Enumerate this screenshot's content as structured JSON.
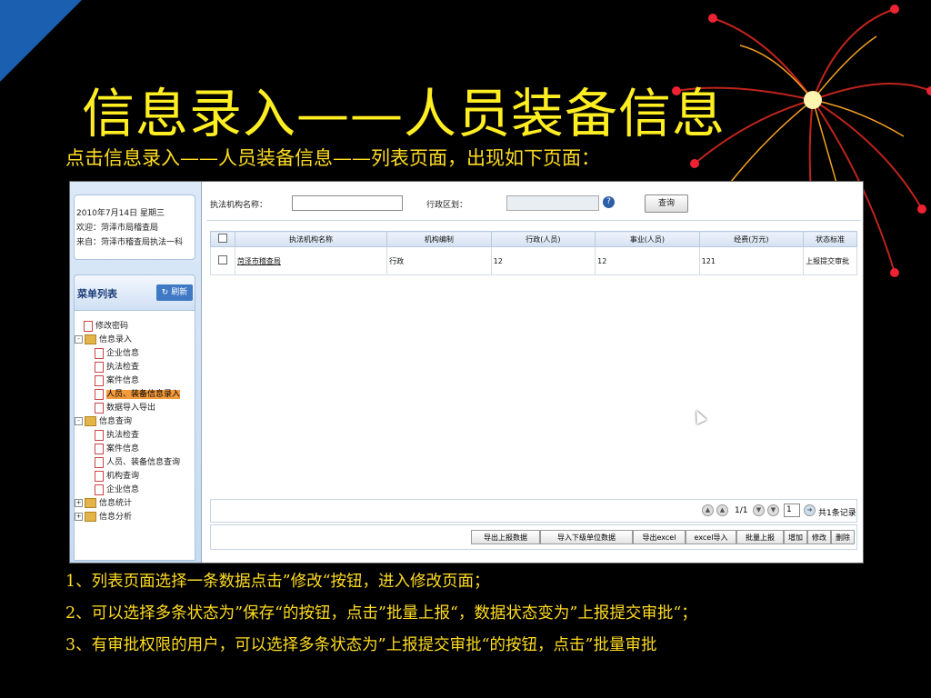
{
  "slide": {
    "title": "信息录入——人员装备信息",
    "subtitle": "点击信息录入——人员装备信息——列表页面，出现如下页面：",
    "notes": [
      "1、列表页面选择一条数据点击”修改“按钮，进入修改页面；",
      "2、可以选择多条状态为”保存“的按钮，点击”批量上报“，数据状态变为”上报提交审批“；",
      "3、有审批权限的用户，可以选择多条状态为”上报提交审批“的按钮，点击”批量审批"
    ]
  },
  "info": {
    "date": "2010年7月14日 星期三",
    "welcome": "欢迎：菏泽市局稽查局",
    "from": "来自：菏泽市稽查局执法一科"
  },
  "menu": {
    "title": "菜单列表",
    "refresh": "刷新",
    "tree": [
      {
        "label": "修改密码"
      },
      {
        "label": "信息录入"
      },
      {
        "label": "企业信息"
      },
      {
        "label": "执法检查"
      },
      {
        "label": "案件信息"
      },
      {
        "label": "人员、装备信息录入"
      },
      {
        "label": "数据导入导出"
      },
      {
        "label": "信息查询"
      },
      {
        "label": "执法检查"
      },
      {
        "label": "案件信息"
      },
      {
        "label": "人员、装备信息查询"
      },
      {
        "label": "机构查询"
      },
      {
        "label": "企业信息"
      },
      {
        "label": "信息统计"
      },
      {
        "label": "信息分析"
      }
    ]
  },
  "search": {
    "org_label": "执法机构名称：",
    "region_label": "行政区划：",
    "org_value": "",
    "region_value": "",
    "query": "查询"
  },
  "table": {
    "headers": [
      "执法机构名称",
      "机构编制",
      "行政(人员)",
      "事业(人员)",
      "经费(万元)",
      "状态标准"
    ],
    "rows": [
      [
        "菏泽市稽查局",
        "行政",
        "12",
        "12",
        "121",
        "上报提交审批"
      ]
    ]
  },
  "pager": {
    "page": "1/1",
    "page_input": "1",
    "total": "共1条记录"
  },
  "actions": [
    "导出上报数据",
    "导入下级单位数据",
    "导出excel",
    "excel导入",
    "批量上报",
    "增加",
    "修改",
    "删除"
  ]
}
